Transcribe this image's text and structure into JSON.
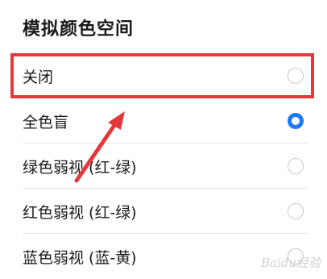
{
  "page": {
    "title": "模拟颜色空间"
  },
  "options": [
    {
      "label": "关闭",
      "selected": false
    },
    {
      "label": "全色盲",
      "selected": true
    },
    {
      "label": "绿色弱视 (红-绿)",
      "selected": false
    },
    {
      "label": "红色弱视 (红-绿)",
      "selected": false
    },
    {
      "label": "蓝色弱视 (蓝-黄)",
      "selected": false
    }
  ],
  "colors": {
    "accent": "#1f7cf0",
    "highlight": "#e5383b"
  },
  "watermark": {
    "text": "Baidu经验"
  }
}
